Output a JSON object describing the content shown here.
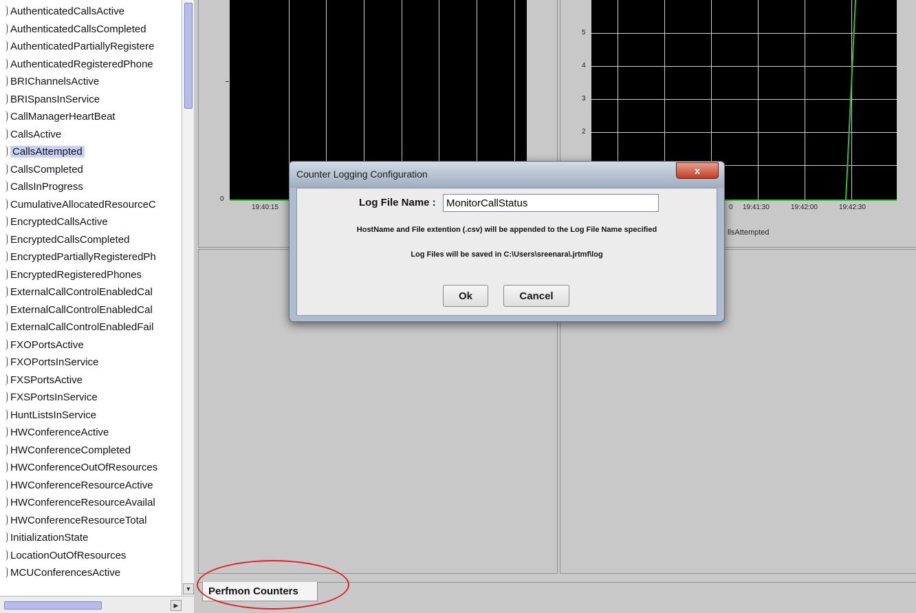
{
  "counter_list": {
    "items": [
      {
        "label": "AuthenticatedCallsActive"
      },
      {
        "label": "AuthenticatedCallsCompleted"
      },
      {
        "label": "AuthenticatedPartiallyRegistere"
      },
      {
        "label": "AuthenticatedRegisteredPhone"
      },
      {
        "label": "BRIChannelsActive"
      },
      {
        "label": "BRISpansInService"
      },
      {
        "label": "CallManagerHeartBeat"
      },
      {
        "label": "CallsActive"
      },
      {
        "label": "CallsAttempted",
        "selected": true
      },
      {
        "label": "CallsCompleted"
      },
      {
        "label": "CallsInProgress"
      },
      {
        "label": "CumulativeAllocatedResourceC"
      },
      {
        "label": "EncryptedCallsActive"
      },
      {
        "label": "EncryptedCallsCompleted"
      },
      {
        "label": "EncryptedPartiallyRegisteredPh"
      },
      {
        "label": "EncryptedRegisteredPhones"
      },
      {
        "label": "ExternalCallControlEnabledCal"
      },
      {
        "label": "ExternalCallControlEnabledCal"
      },
      {
        "label": "ExternalCallControlEnabledFail"
      },
      {
        "label": "FXOPortsActive"
      },
      {
        "label": "FXOPortsInService"
      },
      {
        "label": "FXSPortsActive"
      },
      {
        "label": "FXSPortsInService"
      },
      {
        "label": "HuntListsInService"
      },
      {
        "label": "HWConferenceActive"
      },
      {
        "label": "HWConferenceCompleted"
      },
      {
        "label": "HWConferenceOutOfResources"
      },
      {
        "label": "HWConferenceResourceActive"
      },
      {
        "label": "HWConferenceResourceAvailal"
      },
      {
        "label": "HWConferenceResourceTotal"
      },
      {
        "label": "InitializationState"
      },
      {
        "label": "LocationOutOfResources"
      },
      {
        "label": "MCUConferencesActive"
      }
    ]
  },
  "charts": {
    "left": {
      "y_ticks": [
        "0"
      ],
      "x_ticks": [
        "19:40:15"
      ]
    },
    "right": {
      "y_ticks": [
        "5",
        "4",
        "3",
        "2"
      ],
      "x_ticks": [
        "0",
        "19:41:30",
        "19:42:00",
        "19:42:30"
      ],
      "legend": "llsAttempted"
    }
  },
  "tabs": [
    {
      "label": "Perfmon Counters"
    }
  ],
  "dialog": {
    "title": "Counter Logging Configuration",
    "close_label": "x",
    "log_file_label": "Log File Name :",
    "log_file_value": "MonitorCallStatus",
    "info_line_1": "HostName and File extention (.csv) will be appended to the Log File Name specified",
    "info_line_2": "Log Files will be saved in C:\\Users\\sreenara\\.jrtmf\\log",
    "ok_label": "Ok",
    "cancel_label": "Cancel"
  },
  "colors": {
    "plot_background": "#000000",
    "plot_line": "#2ec02e",
    "selection": "#c9d2f5",
    "annotation": "#e02020"
  }
}
